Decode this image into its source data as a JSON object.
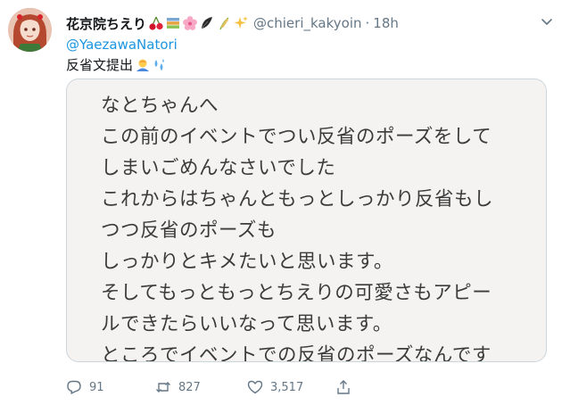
{
  "tweet": {
    "display_name": "花京院ちえり",
    "handle": "@chieri_kakyoin",
    "separator": "·",
    "time": "18h",
    "reply_mention": "@YaezawaNatori",
    "text": "反省文提出",
    "letter_lines": [
      "なとちゃんへ",
      "この前のイベントでつい反省のポーズをして",
      "しまいごめんなさいでした",
      "これからはちゃんともっとしっかり反省もし",
      "つつ反省のポーズも",
      "しっかりとキメたいと思います。",
      "そしてもっともっとちえりの可愛さもアピー",
      "ルできたらいいなって思います。",
      "ところでイベントでの反省のポーズなんです"
    ],
    "stats": {
      "replies": "91",
      "retweets": "827",
      "likes": "3,517"
    }
  },
  "icons": {
    "name_emojis": [
      "cherries-icon",
      "books-icon",
      "cherry-blossom-icon",
      "feather-icon",
      "rice-plant-icon",
      "sparkles-icon"
    ],
    "text_emojis": [
      "person-bowing-icon",
      "sweat-droplets-icon"
    ]
  },
  "colors": {
    "link": "#1b95e0",
    "secondary_text": "#657786",
    "card_background": "#f4f3f2"
  }
}
